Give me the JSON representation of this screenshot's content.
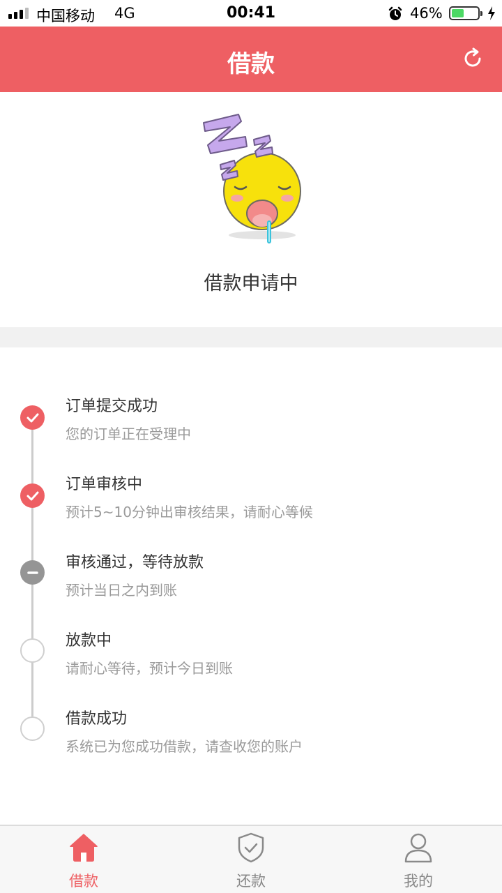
{
  "status_bar": {
    "carrier": "中国移动",
    "network": "4G",
    "time": "00:41",
    "battery_percent": "46%",
    "battery_level": 0.46
  },
  "header": {
    "title": "借款",
    "refresh_icon": "refresh-icon"
  },
  "hero": {
    "icon": "sleeping-face-icon",
    "status_text": "借款申请中"
  },
  "timeline": {
    "steps": [
      {
        "title": "订单提交成功",
        "desc": "您的订单正在受理中",
        "state": "done"
      },
      {
        "title": "订单审核中",
        "desc": "预计5~10分钟出审核结果，请耐心等候",
        "state": "done"
      },
      {
        "title": "审核通过，等待放款",
        "desc": "预计当日之内到账",
        "state": "current"
      },
      {
        "title": "放款中",
        "desc": "请耐心等待，预计今日到账",
        "state": "pending"
      },
      {
        "title": "借款成功",
        "desc": "系统已为您成功借款，请查收您的账户",
        "state": "pending"
      }
    ]
  },
  "tabbar": {
    "tabs": [
      {
        "label": "借款",
        "icon": "home-icon",
        "active": true
      },
      {
        "label": "还款",
        "icon": "shield-check-icon",
        "active": false
      },
      {
        "label": "我的",
        "icon": "user-icon",
        "active": false
      }
    ]
  },
  "colors": {
    "accent": "#ee5f63",
    "current_step": "#959595",
    "battery": "#4cd964"
  }
}
